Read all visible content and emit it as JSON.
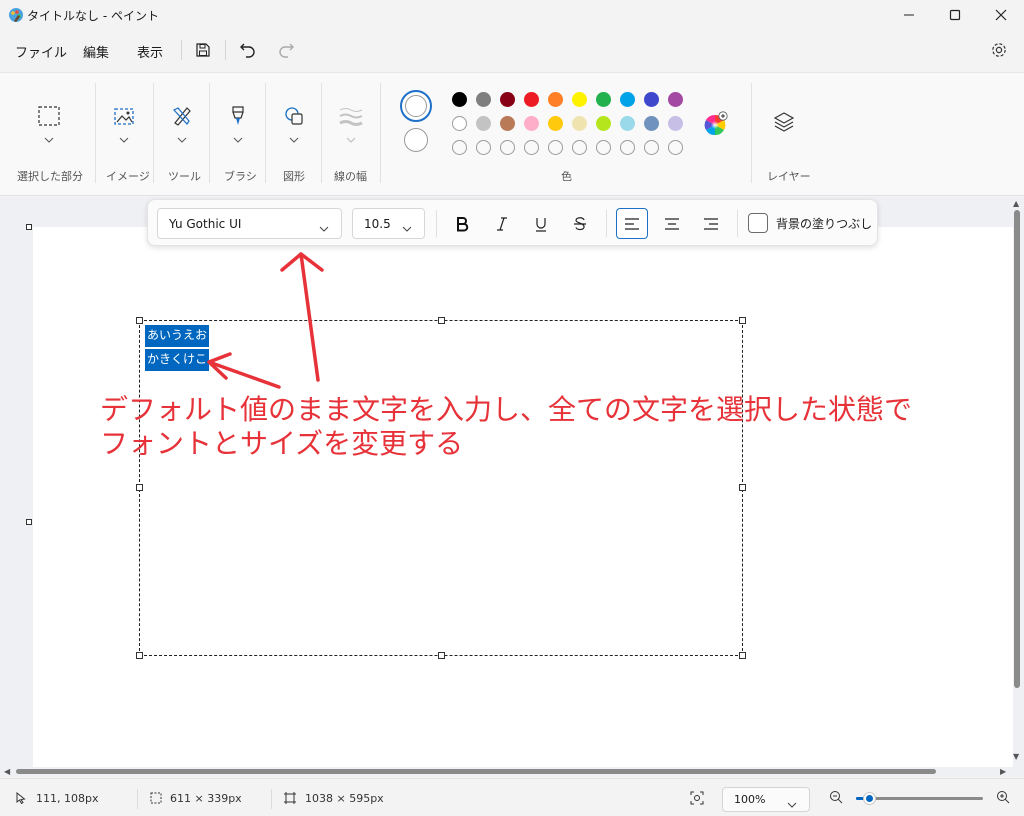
{
  "window": {
    "title": "タイトルなし - ペイント"
  },
  "menu": {
    "file": "ファイル",
    "edit": "編集",
    "view": "表示"
  },
  "ribbon": {
    "selection_label": "選択した部分",
    "image_label": "イメージ",
    "tools_label": "ツール",
    "brush_label": "ブラシ",
    "shapes_label": "図形",
    "line_width_label": "線の幅",
    "colors_label": "色",
    "layers_label": "レイヤー",
    "palette_row1": [
      "#000000",
      "#7f7f7f",
      "#880015",
      "#ed1c24",
      "#ff7f27",
      "#fff200",
      "#22b14c",
      "#00a2e8",
      "#3f48cc",
      "#a349a4"
    ],
    "palette_row2": [
      "#ffffff",
      "#c3c3c3",
      "#b97a57",
      "#ffaec9",
      "#ffc90e",
      "#efe4b0",
      "#b5e61d",
      "#99d9ea",
      "#7092be",
      "#c8bfe7"
    ]
  },
  "text_toolbar": {
    "font_name": "Yu Gothic UI",
    "font_size": "10.5",
    "fill_background_label": "背景の塗りつぶし",
    "fill_background_checked": false,
    "alignment": "left"
  },
  "canvas": {
    "text_lines": [
      "あいうえお",
      "かきくけこ"
    ],
    "annotation_line1": "デフォルト値のまま文字を入力し、全ての文字を選択した状態で",
    "annotation_line2": "フォントとサイズを変更する",
    "annotation_color": "#e63238",
    "selection_color": "#0067c0"
  },
  "status": {
    "cursor_pos": "111, 108px",
    "selection_size": "611 × 339px",
    "canvas_size": "1038 × 595px",
    "zoom": "100%",
    "zoom_level": 0.1
  }
}
